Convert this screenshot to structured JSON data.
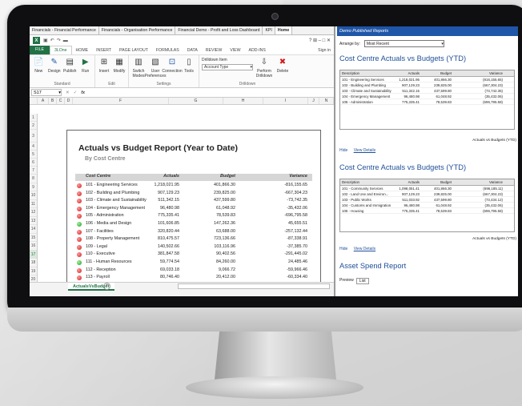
{
  "browser_tabs": [
    {
      "label": "Financials - Financial Performance",
      "active": false
    },
    {
      "label": "Financials - Organisation Performance",
      "active": false
    },
    {
      "label": "Financial Demo - Profit and Loss Dashboard",
      "active": false
    },
    {
      "label": "KPI",
      "active": false
    },
    {
      "label": "Home",
      "active": true
    }
  ],
  "excel": {
    "app_icon": "X",
    "titlebar_icons": "? ⊞ – □ ✕",
    "menu": {
      "file": "FILE",
      "tab_3lone": "3LOne",
      "home": "HOME",
      "insert": "INSERT",
      "page_layout": "PAGE LAYOUT",
      "formulas": "FORMULAS",
      "data": "DATA",
      "review": "REVIEW",
      "view": "VIEW",
      "addins": "ADD-INS",
      "signin": "Sign in"
    },
    "ribbon": {
      "new": "New",
      "design": "Design",
      "publish": "Publish",
      "run": "Run",
      "insert": "Insert",
      "modify": "Modify",
      "switch_modes": "Switch Modes",
      "user_preferences": "User Preferences",
      "connection": "Connection",
      "tools": "Tools",
      "drilldown_item_label": "Drilldown Item",
      "drilldown_item_value": "Account Type",
      "perform_drilldown": "Perform Drilldown",
      "delete": "Delete",
      "group_standard": "Standard",
      "group_edit": "Edit",
      "group_settings": "Settings",
      "group_drilldown": "Drilldown"
    },
    "name_box": "S17",
    "fx": "fx",
    "columns": [
      "A",
      "B",
      "C",
      "D",
      "F",
      "G",
      "H",
      "I",
      "J",
      "N"
    ],
    "rows": [
      "1",
      "2",
      "3",
      "4",
      "5",
      "6",
      "7",
      "8",
      "9",
      "10",
      "11",
      "12",
      "13",
      "14",
      "15",
      "16",
      "17",
      "18",
      "19",
      "20"
    ],
    "selected_row": "17",
    "report": {
      "title": "Actuals vs Budget Report (Year to Date)",
      "subtitle": "By Cost Centre",
      "headers": {
        "cost_centre": "Cost Centre",
        "actuals": "Actuals",
        "budget": "Budget",
        "variance": "Variance"
      },
      "rows": [
        {
          "status": "red",
          "name": "101 - Engineering Services",
          "actuals": "1,218,021.95",
          "budget": "401,866.30",
          "variance": "-816,155.65"
        },
        {
          "status": "red",
          "name": "102 - Building and Plumbing",
          "actuals": "907,129.23",
          "budget": "239,825.00",
          "variance": "-667,304.23"
        },
        {
          "status": "red",
          "name": "103 - Climate and Sustainability",
          "actuals": "511,342.15",
          "budget": "437,599.80",
          "variance": "-73,742.35"
        },
        {
          "status": "red",
          "name": "104 - Emergency Management",
          "actuals": "96,480.98",
          "budget": "61,048.92",
          "variance": "-35,432.06"
        },
        {
          "status": "red",
          "name": "105 - Administration",
          "actuals": "775,335.41",
          "budget": "78,539.83",
          "variance": "-696,795.58"
        },
        {
          "status": "green",
          "name": "106 - Media and Design",
          "actuals": "101,606.85",
          "budget": "147,262.36",
          "variance": "45,655.51"
        },
        {
          "status": "red",
          "name": "107 - Facilities",
          "actuals": "320,820.44",
          "budget": "63,688.00",
          "variance": "-257,132.44"
        },
        {
          "status": "red",
          "name": "108 - Property Management",
          "actuals": "810,475.57",
          "budget": "723,136.66",
          "variance": "-87,338.91"
        },
        {
          "status": "red",
          "name": "109 - Legal",
          "actuals": "140,502.66",
          "budget": "103,116.96",
          "variance": "-37,385.70"
        },
        {
          "status": "red",
          "name": "110 - Executive",
          "actuals": "381,847.58",
          "budget": "90,402.56",
          "variance": "-291,445.02"
        },
        {
          "status": "green",
          "name": "111 - Human Resources",
          "actuals": "59,774.54",
          "budget": "84,260.00",
          "variance": "24,485.46"
        },
        {
          "status": "red",
          "name": "112 - Reception",
          "actuals": "69,033.18",
          "budget": "9,066.72",
          "variance": "-59,966.46"
        },
        {
          "status": "red",
          "name": "113 - Payroll",
          "actuals": "80,746.40",
          "budget": "20,412.00",
          "variance": "-60,334.40"
        }
      ]
    },
    "sheet_tab": "ActualsVsBudget",
    "add_sheet": "+"
  },
  "panel": {
    "title": "Demo Published Reports",
    "arrange_label": "Arrange by:",
    "arrange_value": "Most Recent",
    "widgets": [
      {
        "title": "Cost Centre Actuals vs Budgets (YTD)",
        "headers": {
          "desc": "Description",
          "actuals": "Actuals",
          "budget": "Budget",
          "variance": "Variance"
        },
        "rows": [
          {
            "desc": "101 - Engineering Services",
            "actuals": "1,218,021.95",
            "budget": "401,866.30",
            "variance": "(816,155.65)"
          },
          {
            "desc": "102 - Building and Plumbing",
            "actuals": "907,129.23",
            "budget": "239,825.00",
            "variance": "(667,304.23)"
          },
          {
            "desc": "103 - Climate and Sustainability",
            "actuals": "511,342.15",
            "budget": "437,599.80",
            "variance": "(73,742.35)"
          },
          {
            "desc": "104 - Emergency Management",
            "actuals": "96,480.98",
            "budget": "61,048.92",
            "variance": "(35,432.06)"
          },
          {
            "desc": "105 - Administration",
            "actuals": "775,335.41",
            "budget": "78,539.83",
            "variance": "(696,795.58)"
          }
        ],
        "footer": "Actuals vs Budgets (YTD)",
        "hide": "Hide",
        "view": "View Details"
      },
      {
        "title": "Cost Centre Actuals vs Budgets (YTD)",
        "headers": {
          "desc": "Description",
          "actuals": "Actuals",
          "budget": "Budget",
          "variance": "Variance"
        },
        "rows": [
          {
            "desc": "101 - Community Services",
            "actuals": "1,098,051.41",
            "budget": "401,866.30",
            "variance": "(696,185.11)"
          },
          {
            "desc": "102 - Land Use and Environ...",
            "actuals": "907,129.23",
            "budget": "239,825.00",
            "variance": "(667,304.23)"
          },
          {
            "desc": "103 - Public Works",
            "actuals": "511,033.92",
            "budget": "437,599.80",
            "variance": "(73,434.12)"
          },
          {
            "desc": "104 - Customs and Immigration",
            "actuals": "96,480.98",
            "budget": "61,048.92",
            "variance": "(35,432.06)"
          },
          {
            "desc": "105 - Housing",
            "actuals": "775,335.41",
            "budget": "78,539.83",
            "variance": "(696,795.58)"
          }
        ],
        "footer": "Actuals vs Budgets (YTD)",
        "hide": "Hide",
        "view": "View Details"
      }
    ],
    "asset_title": "Asset Spend Report",
    "asset_sub": "Preview",
    "asset_sub2": "List"
  },
  "colors": {
    "excel_green": "#217346",
    "panel_blue": "#1f56a8",
    "title_blue": "#1f4f99",
    "status_red": "#d01c1c",
    "status_green": "#1f9a1f"
  }
}
